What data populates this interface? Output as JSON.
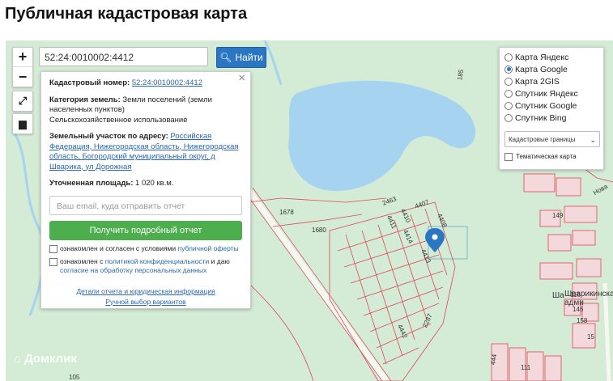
{
  "page": {
    "title": "Публичная кадастровая карта"
  },
  "search": {
    "value": "52:24:0010002:4412",
    "button_label": "Найти"
  },
  "controls": {
    "zoom_in": "+",
    "zoom_out": "−"
  },
  "info_panel": {
    "cadastral_label": "Кадастровый номер:",
    "cadastral_value": "52:24:0010002:4412",
    "category_label": "Категория земель:",
    "category_value": "Земли поселений (земли населенных пунктов)",
    "usage_value": "Сельскохозяйственное использование",
    "address_label": "Земельный участок по адресу:",
    "address_value": "Российская Федерация, Нижегородская область, Нижегородская область, Богородский муниципальный округ, д Шварика, ул Дорожная",
    "area_label": "Уточненная площадь:",
    "area_value": "1 020 кв.м.",
    "email_placeholder": "Ваш email, куда отправить отчет",
    "report_button": "Получить подробный отчет",
    "consent1_prefix": "ознакомлен и согласен с условиями",
    "consent1_link": "публичной оферты",
    "consent2_prefix": "ознакомлен с",
    "consent2_link": "политикой конфиденциальности",
    "consent2_mid": "и даю",
    "consent2_link2": "согласие на обработку персональных данных",
    "details_link": "Детали отчета и юридическая информация",
    "manual_link": "Ручной выбор вариантов"
  },
  "layers": {
    "options": [
      {
        "label": "Карта Яндекс",
        "selected": false
      },
      {
        "label": "Карта Google",
        "selected": true
      },
      {
        "label": "Карта 2GIS",
        "selected": false
      },
      {
        "label": "Спутник Яндекс",
        "selected": false
      },
      {
        "label": "Спутник Google",
        "selected": false
      },
      {
        "label": "Спутник Bing",
        "selected": false
      }
    ],
    "select_value": "Кадастровые границы",
    "thematic_label": "Тематическая карта"
  },
  "map": {
    "watermark": "Домклик",
    "parcel_labels": [
      "185",
      "1678",
      "1680",
      "2463",
      "4407",
      "4410",
      "4411",
      "4414",
      "4413",
      "4408",
      "2287",
      "4442",
      "444",
      "111",
      "105",
      "149",
      "116",
      "146",
      "158",
      "15",
      "Ша",
      "Шварикинска адми",
      "Нова"
    ],
    "colors": {
      "water": "#a6d3ef",
      "land": "#d4ecd5",
      "parcel_line": "#e0455a",
      "marker": "#2b76c2"
    }
  }
}
